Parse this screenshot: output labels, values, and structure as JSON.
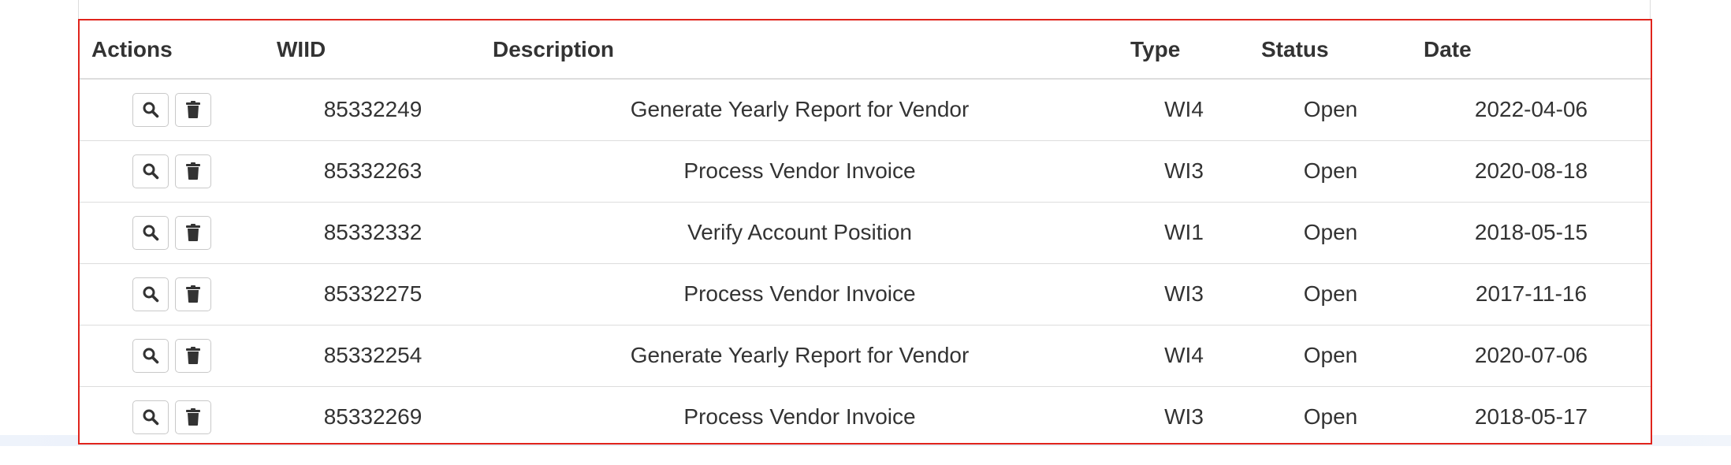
{
  "table": {
    "headers": {
      "actions": "Actions",
      "wiid": "WIID",
      "description": "Description",
      "type": "Type",
      "status": "Status",
      "date": "Date"
    },
    "rows": [
      {
        "wiid": "85332249",
        "description": "Generate Yearly Report for Vendor",
        "type": "WI4",
        "status": "Open",
        "date": "2022-04-06"
      },
      {
        "wiid": "85332263",
        "description": "Process Vendor Invoice",
        "type": "WI3",
        "status": "Open",
        "date": "2020-08-18"
      },
      {
        "wiid": "85332332",
        "description": "Verify Account Position",
        "type": "WI1",
        "status": "Open",
        "date": "2018-05-15"
      },
      {
        "wiid": "85332275",
        "description": "Process Vendor Invoice",
        "type": "WI3",
        "status": "Open",
        "date": "2017-11-16"
      },
      {
        "wiid": "85332254",
        "description": "Generate Yearly Report for Vendor",
        "type": "WI4",
        "status": "Open",
        "date": "2020-07-06"
      },
      {
        "wiid": "85332269",
        "description": "Process Vendor Invoice",
        "type": "WI3",
        "status": "Open",
        "date": "2018-05-17"
      }
    ],
    "row_actions": [
      {
        "icon": "search-icon"
      },
      {
        "icon": "trash-icon"
      }
    ]
  },
  "colors": {
    "highlight_border": "#e0241c",
    "text": "#333333",
    "divider": "#dddddd"
  }
}
